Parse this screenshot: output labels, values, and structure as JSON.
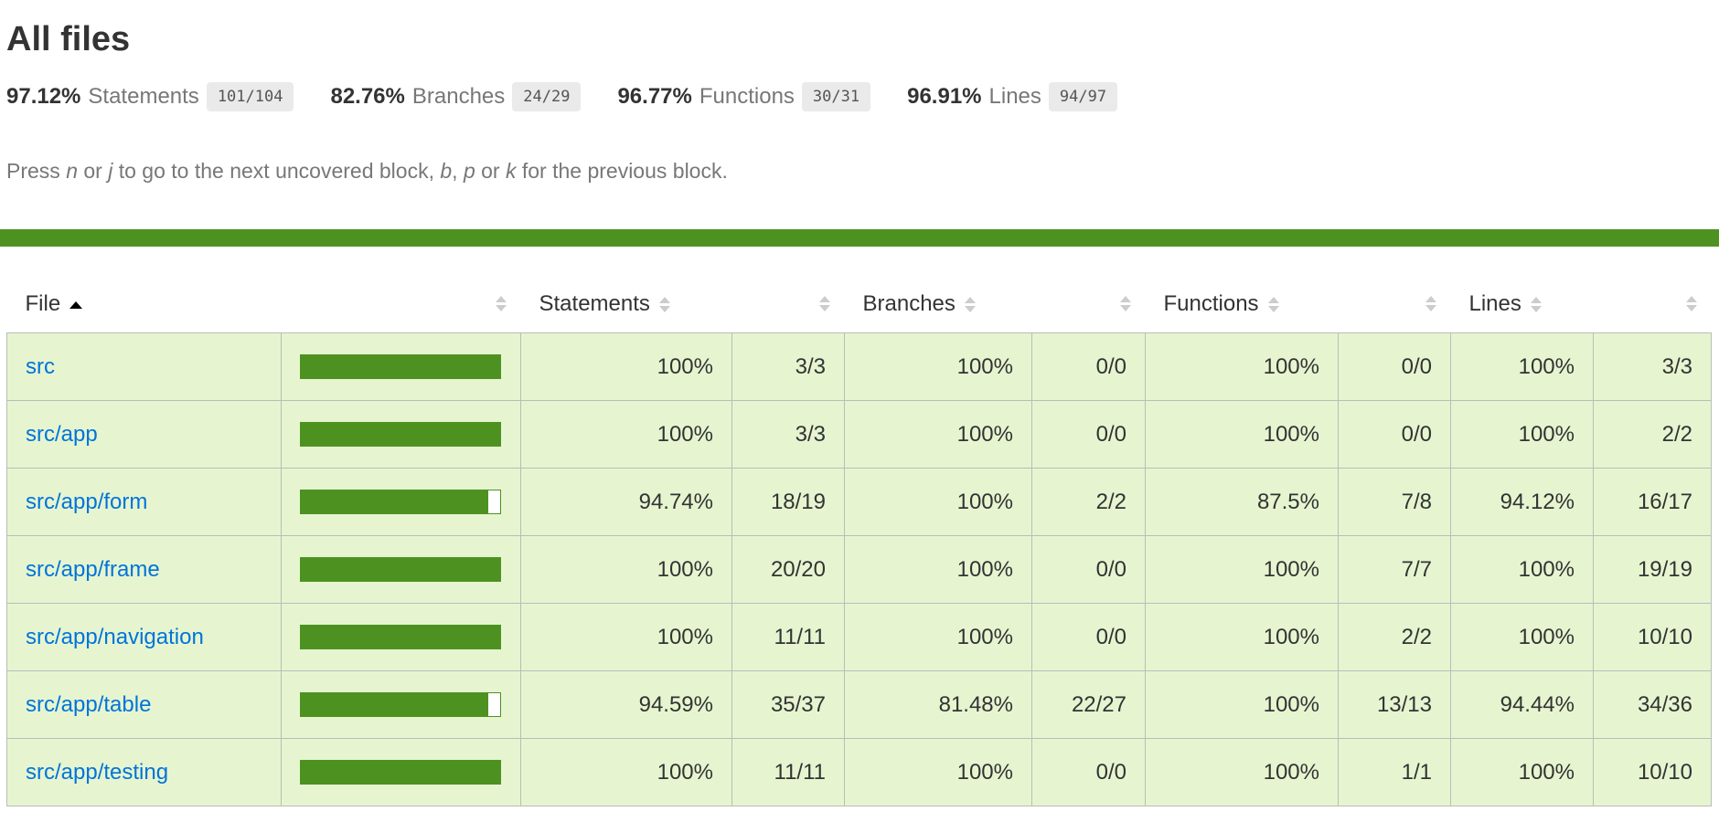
{
  "title": "All files",
  "summary": [
    {
      "pct": "97.12%",
      "label": "Statements",
      "fraction": "101/104"
    },
    {
      "pct": "82.76%",
      "label": "Branches",
      "fraction": "24/29"
    },
    {
      "pct": "96.77%",
      "label": "Functions",
      "fraction": "30/31"
    },
    {
      "pct": "96.91%",
      "label": "Lines",
      "fraction": "94/97"
    }
  ],
  "hint": {
    "press": "Press",
    "n": "n",
    "or1": "or",
    "j": "j",
    "mid": "to go to the next uncovered block,",
    "b": "b",
    "comma": ",",
    "p": "p",
    "or2": "or",
    "k": "k",
    "end": "for the previous block."
  },
  "colors": {
    "status_bar": "#4d9221",
    "row_high": "#e6f5d0",
    "link": "#0074d9"
  },
  "table": {
    "headers": {
      "file": "File",
      "statements": "Statements",
      "branches": "Branches",
      "functions": "Functions",
      "lines": "Lines"
    },
    "sort": {
      "column": "File",
      "direction": "ascending"
    },
    "rows": [
      {
        "file": "src",
        "coverage": 100,
        "s_pct": "100%",
        "s_frac": "3/3",
        "b_pct": "100%",
        "b_frac": "0/0",
        "f_pct": "100%",
        "f_frac": "0/0",
        "l_pct": "100%",
        "l_frac": "3/3"
      },
      {
        "file": "src/app",
        "coverage": 100,
        "s_pct": "100%",
        "s_frac": "3/3",
        "b_pct": "100%",
        "b_frac": "0/0",
        "f_pct": "100%",
        "f_frac": "0/0",
        "l_pct": "100%",
        "l_frac": "2/2"
      },
      {
        "file": "src/app/form",
        "coverage": 94.74,
        "s_pct": "94.74%",
        "s_frac": "18/19",
        "b_pct": "100%",
        "b_frac": "2/2",
        "f_pct": "87.5%",
        "f_frac": "7/8",
        "l_pct": "94.12%",
        "l_frac": "16/17"
      },
      {
        "file": "src/app/frame",
        "coverage": 100,
        "s_pct": "100%",
        "s_frac": "20/20",
        "b_pct": "100%",
        "b_frac": "0/0",
        "f_pct": "100%",
        "f_frac": "7/7",
        "l_pct": "100%",
        "l_frac": "19/19"
      },
      {
        "file": "src/app/navigation",
        "coverage": 100,
        "s_pct": "100%",
        "s_frac": "11/11",
        "b_pct": "100%",
        "b_frac": "0/0",
        "f_pct": "100%",
        "f_frac": "2/2",
        "l_pct": "100%",
        "l_frac": "10/10"
      },
      {
        "file": "src/app/table",
        "coverage": 94.59,
        "s_pct": "94.59%",
        "s_frac": "35/37",
        "b_pct": "81.48%",
        "b_frac": "22/27",
        "f_pct": "100%",
        "f_frac": "13/13",
        "l_pct": "94.44%",
        "l_frac": "34/36"
      },
      {
        "file": "src/app/testing",
        "coverage": 100,
        "s_pct": "100%",
        "s_frac": "11/11",
        "b_pct": "100%",
        "b_frac": "0/0",
        "f_pct": "100%",
        "f_frac": "1/1",
        "l_pct": "100%",
        "l_frac": "10/10"
      }
    ]
  }
}
